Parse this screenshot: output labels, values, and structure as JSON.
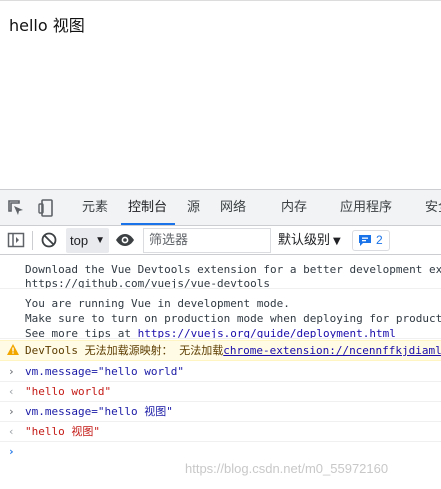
{
  "page": {
    "heading": "hello 视图"
  },
  "devtools": {
    "tabs": [
      {
        "label": "元素"
      },
      {
        "label": "控制台"
      },
      {
        "label": "源"
      },
      {
        "label": "网络"
      },
      {
        "label": "内存"
      },
      {
        "label": "应用程序"
      },
      {
        "label": "安全"
      }
    ],
    "active_tab": "控制台",
    "toolbar": {
      "context": "top",
      "filter_placeholder": "筛选器",
      "level": "默认级别",
      "issues_count": "2"
    },
    "console": {
      "devtools_line1": "Download the Vue Devtools extension for a better development experience:",
      "devtools_link": "https://github.com/vuejs/vue-devtools",
      "dev_line1": "You are running Vue in development mode.",
      "dev_line2": "Make sure to turn on production mode when deploying for production.",
      "dev_line3_prefix": "See more tips at ",
      "dev_link": "https://vuejs.org/guide/deployment.html",
      "warn_prefix": "DevTools 无法加载源映射： 无法加载",
      "warn_link": "chrome-extension://ncennffkjdiamlpmcbajkmaiiiddgioo/build/backend.js.map",
      "input1": "vm.message=\"hello world\"",
      "output1": "\"hello world\"",
      "input2": "vm.message=\"hello 视图\"",
      "output2": "\"hello 视图\""
    }
  },
  "watermark": "https://blog.csdn.net/m0_55972160",
  "colors": {
    "accent": "#1a73e8",
    "link": "#1a0dab",
    "warning_bg": "#fffbe5",
    "string_output": "#c41a16"
  },
  "icons": [
    "inspect-element-icon",
    "device-toolbar-icon",
    "sidebar-toggle-icon",
    "clear-console-icon",
    "eye-icon",
    "issues-icon",
    "warning-icon"
  ]
}
